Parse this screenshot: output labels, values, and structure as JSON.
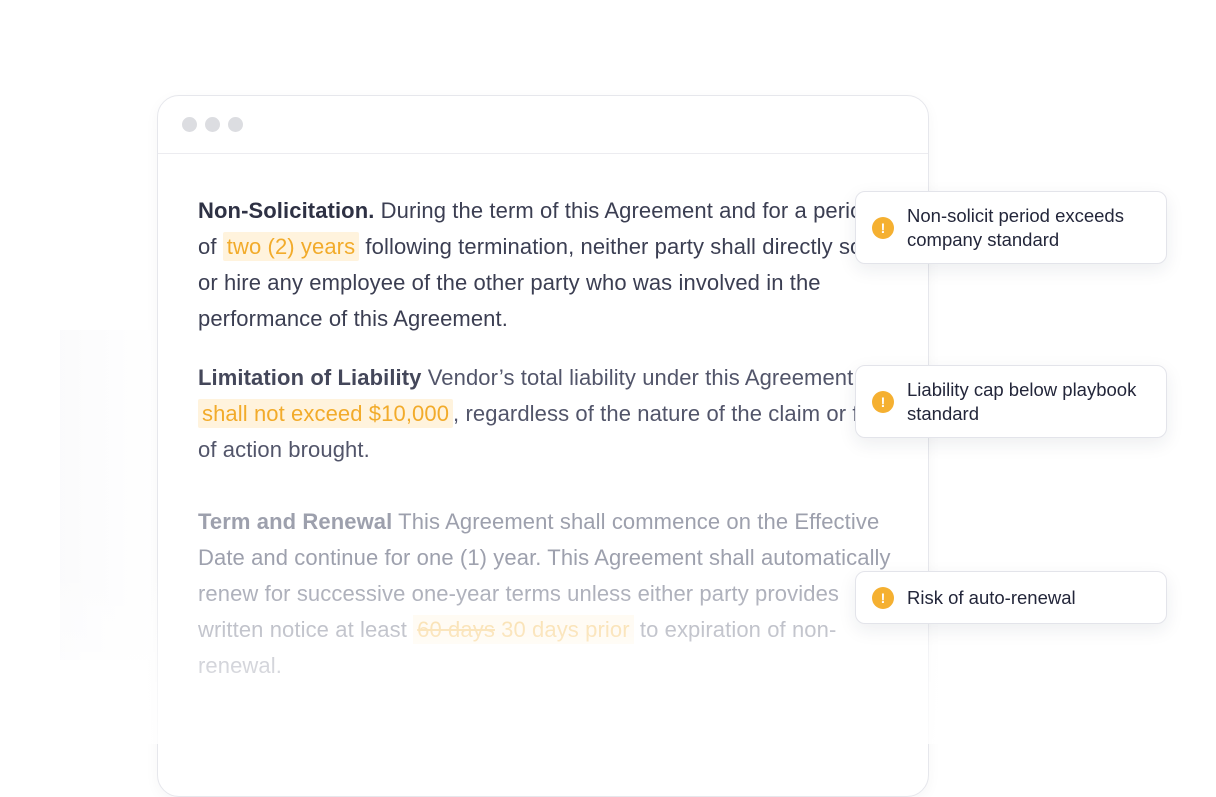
{
  "document": {
    "non_solicitation": {
      "heading": "Non-Solicitation.",
      "text_before": " During the term of this Agreement and for a period of ",
      "highlight": "two (2) years",
      "text_after": " following termination, neither party shall directly solicit or hire any employee of the other party who was involved in the performance of this Agreement."
    },
    "limitation_of_liability": {
      "heading": "Limitation of Liability",
      "text_before": " Vendor’s total liability under this Agreement ",
      "highlight": "shall not exceed $10,000",
      "text_after": ", regardless of the nature of the claim or form of action brought."
    },
    "term_and_renewal": {
      "heading": "Term and Renewal",
      "text_before": " This Agreement shall commence on the Effective Date and continue for one (1) year. This Agreement shall automatically renew for successive one-year terms unless either party provides written notice at least ",
      "struck": "60 days",
      "replacement": " 30 days prior",
      "text_after": " to expiration of non-renewal."
    }
  },
  "annotations": [
    {
      "icon": "warning-icon",
      "symbol": "!",
      "text": "Non-solicit period exceeds company standard"
    },
    {
      "icon": "warning-icon",
      "symbol": "!",
      "text": "Liability cap below playbook standard"
    },
    {
      "icon": "warning-icon",
      "symbol": "!",
      "text": "Risk of auto-renewal"
    }
  ],
  "colors": {
    "highlight_text": "#f2ab2a",
    "highlight_bg": "#fff3dd",
    "warning": "#f5b031"
  }
}
